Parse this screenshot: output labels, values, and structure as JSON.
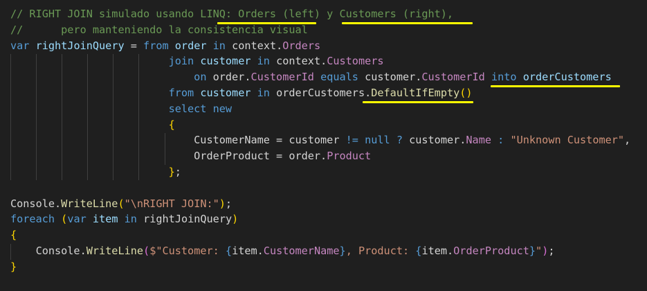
{
  "editor": {
    "lines": [
      [
        {
          "t": "// RIGHT JOIN simulado usando LINQ: Orders (left) y Customers (right),",
          "c": "c"
        }
      ],
      [
        {
          "t": "//      pero manteniendo la consistencia visual",
          "c": "c"
        }
      ],
      [
        {
          "t": "var",
          "c": "k"
        },
        {
          "t": " ",
          "c": "o"
        },
        {
          "t": "rightJoinQuery",
          "c": "v"
        },
        {
          "t": " = ",
          "c": "o"
        },
        {
          "t": "from",
          "c": "k"
        },
        {
          "t": " ",
          "c": "o"
        },
        {
          "t": "order",
          "c": "v"
        },
        {
          "t": " ",
          "c": "o"
        },
        {
          "t": "in",
          "c": "k"
        },
        {
          "t": " context.",
          "c": "t"
        },
        {
          "t": "Orders",
          "c": "p"
        }
      ],
      [
        {
          "t": "                         ",
          "c": "o"
        },
        {
          "t": "join",
          "c": "k"
        },
        {
          "t": " ",
          "c": "o"
        },
        {
          "t": "customer",
          "c": "v"
        },
        {
          "t": " ",
          "c": "o"
        },
        {
          "t": "in",
          "c": "k"
        },
        {
          "t": " context.",
          "c": "t"
        },
        {
          "t": "Customers",
          "c": "p"
        }
      ],
      [
        {
          "t": "                             ",
          "c": "o"
        },
        {
          "t": "on",
          "c": "k"
        },
        {
          "t": " order.",
          "c": "t"
        },
        {
          "t": "CustomerId",
          "c": "p"
        },
        {
          "t": " ",
          "c": "o"
        },
        {
          "t": "equals",
          "c": "k"
        },
        {
          "t": " customer.",
          "c": "t"
        },
        {
          "t": "CustomerId",
          "c": "p"
        },
        {
          "t": " ",
          "c": "o"
        },
        {
          "t": "into",
          "c": "k"
        },
        {
          "t": " ",
          "c": "o"
        },
        {
          "t": "orderCustomers",
          "c": "v"
        }
      ],
      [
        {
          "t": "                         ",
          "c": "o"
        },
        {
          "t": "from",
          "c": "k"
        },
        {
          "t": " ",
          "c": "o"
        },
        {
          "t": "customer",
          "c": "v"
        },
        {
          "t": " ",
          "c": "o"
        },
        {
          "t": "in",
          "c": "k"
        },
        {
          "t": " orderCustomers.",
          "c": "t"
        },
        {
          "t": "DefaultIfEmpty",
          "c": "f"
        },
        {
          "t": "()",
          "c": "y"
        }
      ],
      [
        {
          "t": "                         ",
          "c": "o"
        },
        {
          "t": "select",
          "c": "k"
        },
        {
          "t": " ",
          "c": "o"
        },
        {
          "t": "new",
          "c": "k"
        }
      ],
      [
        {
          "t": "                         ",
          "c": "o"
        },
        {
          "t": "{",
          "c": "y"
        }
      ],
      [
        {
          "t": "                             CustomerName = customer ",
          "c": "t"
        },
        {
          "t": "!=",
          "c": "k"
        },
        {
          "t": " ",
          "c": "o"
        },
        {
          "t": "null",
          "c": "k"
        },
        {
          "t": " ",
          "c": "o"
        },
        {
          "t": "?",
          "c": "k"
        },
        {
          "t": " customer.",
          "c": "t"
        },
        {
          "t": "Name",
          "c": "p"
        },
        {
          "t": " ",
          "c": "o"
        },
        {
          "t": ":",
          "c": "k"
        },
        {
          "t": " ",
          "c": "o"
        },
        {
          "t": "\"Unknown Customer\"",
          "c": "s"
        },
        {
          "t": ",",
          "c": "t"
        }
      ],
      [
        {
          "t": "                             OrderProduct = order.",
          "c": "t"
        },
        {
          "t": "Product",
          "c": "p"
        }
      ],
      [
        {
          "t": "                         ",
          "c": "o"
        },
        {
          "t": "}",
          "c": "y"
        },
        {
          "t": ";",
          "c": "t"
        }
      ],
      [
        {
          "t": "",
          "c": "o"
        }
      ],
      [
        {
          "t": "Console.",
          "c": "t"
        },
        {
          "t": "WriteLine",
          "c": "f"
        },
        {
          "t": "(",
          "c": "y"
        },
        {
          "t": "\"\\nRIGHT JOIN:\"",
          "c": "s"
        },
        {
          "t": ")",
          "c": "y"
        },
        {
          "t": ";",
          "c": "t"
        }
      ],
      [
        {
          "t": "foreach",
          "c": "k"
        },
        {
          "t": " ",
          "c": "o"
        },
        {
          "t": "(",
          "c": "y"
        },
        {
          "t": "var",
          "c": "k"
        },
        {
          "t": " ",
          "c": "o"
        },
        {
          "t": "item",
          "c": "v"
        },
        {
          "t": " ",
          "c": "o"
        },
        {
          "t": "in",
          "c": "k"
        },
        {
          "t": " rightJoinQuery",
          "c": "t"
        },
        {
          "t": ")",
          "c": "y"
        }
      ],
      [
        {
          "t": "{",
          "c": "y"
        }
      ],
      [
        {
          "t": "    Console.",
          "c": "t"
        },
        {
          "t": "WriteLine",
          "c": "f"
        },
        {
          "t": "(",
          "c": "m"
        },
        {
          "t": "$\"Customer: ",
          "c": "s"
        },
        {
          "t": "{",
          "c": "k"
        },
        {
          "t": "item.",
          "c": "t"
        },
        {
          "t": "CustomerName",
          "c": "p"
        },
        {
          "t": "}",
          "c": "k"
        },
        {
          "t": ", Product: ",
          "c": "s"
        },
        {
          "t": "{",
          "c": "k"
        },
        {
          "t": "item.",
          "c": "t"
        },
        {
          "t": "OrderProduct",
          "c": "p"
        },
        {
          "t": "}",
          "c": "k"
        },
        {
          "t": "\"",
          "c": "s"
        },
        {
          "t": ")",
          "c": "m"
        },
        {
          "t": ";",
          "c": "t"
        }
      ],
      [
        {
          "t": "}",
          "c": "y"
        }
      ]
    ],
    "annotation_color": "#ffff00",
    "annotated_terms": [
      "Orders (left)",
      "Customers (right),",
      "into orderCustomers",
      ".DefaultIfEmpty()"
    ]
  }
}
